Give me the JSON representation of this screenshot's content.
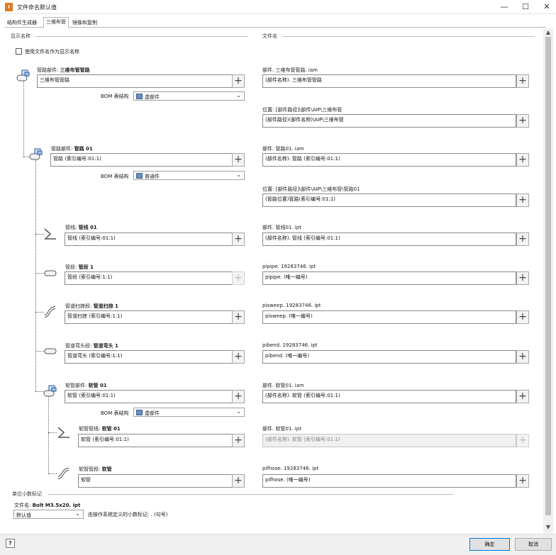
{
  "window": {
    "app_icon": "I",
    "title": "文件命名默认值",
    "minimize": "—",
    "maximize": "☐",
    "close": "✕"
  },
  "tabs": [
    "结构件生成器",
    "三维布管",
    "镜像和复制"
  ],
  "headers": {
    "display_name": "显示名称",
    "file_name": "文件名"
  },
  "use_filename_checkbox": {
    "label": "使用文件名作为显示名称",
    "checked": false
  },
  "nodes": [
    {
      "id": "tube-pipe-assembly",
      "label_prefix": "管路部件: ",
      "label_bold": "三维布管管路",
      "display_value": "三维布管管路",
      "bom_label": "BOM 表结构",
      "bom_value": "虚部件",
      "file_label": "部件. 三维布管管路. iam",
      "file_value": "(部件名称). 三维布管管路",
      "location_label": "位置: [部件路径]\\部件\\AIP\\三维布管",
      "location_value": "(部件路径)(部件名称)\\AIP\\三维布管"
    },
    {
      "id": "pipe-run",
      "label_prefix": "管路部件: ",
      "label_bold": "管路 01",
      "display_value": "管路 (索引编号:01:1)",
      "bom_label": "BOM 表结构",
      "bom_value": "普通件",
      "file_label": "部件. 管路01. iam",
      "file_value": "(部件名称). 管路 (索引编号:01:1)",
      "location_label": "位置: [部件路径]\\部件\\AIP\\三维布管\\管路01",
      "location_value": "(管路位置)管路(索引编号:01:1)"
    },
    {
      "id": "route",
      "label_prefix": "管线: ",
      "label_bold": "管线 01",
      "display_value": "管线 (索引编号:01:1)",
      "file_label": "部件. 管线01. ipt",
      "file_value": "(部件名称). 管线 (索引编号:01:1)"
    },
    {
      "id": "pipe-segment",
      "label_prefix": "管段: ",
      "label_bold": "管段 1",
      "display_value": "管段 (索引编号:1:1)",
      "file_label": "pipipe. 19283746. ipt",
      "file_value": "pipipe. (唯一编号)"
    },
    {
      "id": "pipe-sweep",
      "label_prefix": "管道扫掠段: ",
      "label_bold": "管道扫掠 1",
      "display_value": "管道扫掠 (索引编号:1:1)",
      "file_label": "pisweep. 19283746. ipt",
      "file_value": "pisweep. (唯一编号)"
    },
    {
      "id": "pipe-bend",
      "label_prefix": "管道弯头段: ",
      "label_bold": "管道弯头 1",
      "display_value": "管道弯头 (索引编号:1:1)",
      "file_label": "pibend. 19283746. ipt",
      "file_value": "pibend. (唯一编号)"
    },
    {
      "id": "hose-assembly",
      "label_prefix": "软管部件: ",
      "label_bold": "软管 01",
      "display_value": "软管 (索引编号:01:1)",
      "bom_label": "BOM 表结构",
      "bom_value": "虚部件",
      "file_label": "部件. 软管01. iam",
      "file_value": "(部件名称). 软管 (索引编号:01:1)"
    },
    {
      "id": "hose-route",
      "label_prefix": "软管管线: ",
      "label_bold": "软管 01",
      "display_value": "软管 (索引编号:01:1)",
      "file_label": "部件. 软管01. ipt",
      "file_value": "(部件名称). 软管 (索引编号:01:1)",
      "file_disabled": true
    },
    {
      "id": "hose-segment",
      "label_prefix": "软管管段: ",
      "label_bold": "软管",
      "display_value": "软管",
      "file_label": "pifhose. 19283746. ipt",
      "file_value": "pifhose. (唯一编号)"
    }
  ],
  "decimal_section": {
    "header": "单位小数标记",
    "filename_prefix": "文件名: ",
    "filename_bold": "Bolt M3.5x20. ipt",
    "select_value": "默认值",
    "note": "由操作系统定义的小数标记: . (句号)"
  },
  "buttons": {
    "help": "?",
    "ok": "确定",
    "cancel": "取消"
  },
  "scrollbar": {
    "up": "▲",
    "down": "▼"
  }
}
